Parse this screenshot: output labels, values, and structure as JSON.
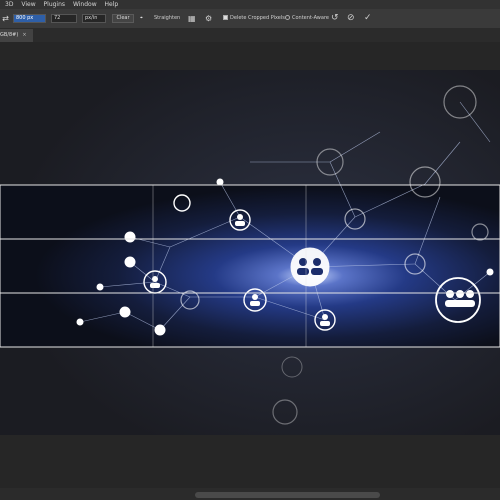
{
  "menubar": {
    "items": [
      "3D",
      "View",
      "Plugins",
      "Window",
      "Help"
    ]
  },
  "options": {
    "width_value": "800 px",
    "resolution_value": "72",
    "resolution_unit": "px/in",
    "clear_label": "Clear",
    "straighten_label": "Straighten",
    "delete_cropped_label": "Delete Cropped Pixels",
    "content_aware_label": "Content-Aware"
  },
  "document_tab": {
    "label": "GB/8#)",
    "close": "×"
  },
  "colors": {
    "ui_dark": "#282828",
    "menu_bg": "#323232",
    "option_bg": "#3a3a3a",
    "crop_line": "#e6e6e6",
    "network_blue": "#1b2d6b"
  }
}
